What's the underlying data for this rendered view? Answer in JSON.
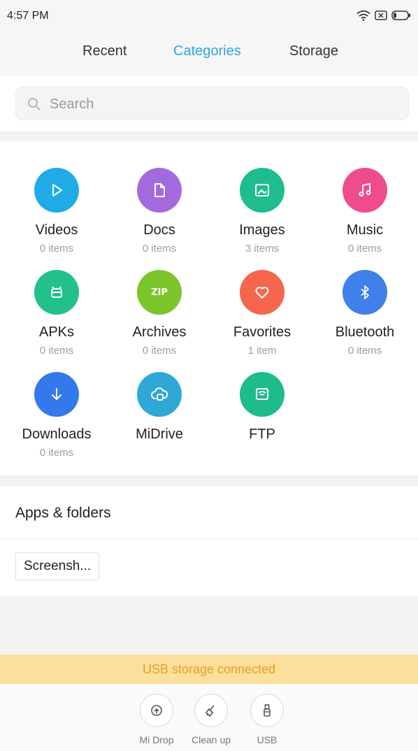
{
  "status_bar": {
    "time": "4:57 PM"
  },
  "tabs": [
    {
      "label": "Recent"
    },
    {
      "label": "Categories",
      "active": true
    },
    {
      "label": "Storage"
    }
  ],
  "search": {
    "placeholder": "Search"
  },
  "categories": [
    {
      "label": "Videos",
      "count": "0 items",
      "color": "#1eabe8",
      "icon": "play-icon"
    },
    {
      "label": "Docs",
      "count": "0 items",
      "color": "#a36ae0",
      "icon": "document-icon"
    },
    {
      "label": "Images",
      "count": "3 items",
      "color": "#1ebd8f",
      "icon": "image-icon"
    },
    {
      "label": "Music",
      "count": "0 items",
      "color": "#f04b8e",
      "icon": "music-note-icon"
    },
    {
      "label": "APKs",
      "count": "0 items",
      "color": "#22c08d",
      "icon": "android-icon"
    },
    {
      "label": "Archives",
      "count": "0 items",
      "color": "#7cc52b",
      "icon": "zip-icon",
      "icon_text": "ZIP"
    },
    {
      "label": "Favorites",
      "count": "1 item",
      "color": "#f4664d",
      "icon": "heart-icon"
    },
    {
      "label": "Bluetooth",
      "count": "0 items",
      "color": "#3f80ea",
      "icon": "bluetooth-icon"
    },
    {
      "label": "Downloads",
      "count": "0 items",
      "color": "#3479ea",
      "icon": "download-arrow-icon"
    },
    {
      "label": "MiDrive",
      "color": "#2fa8d8",
      "icon": "cloud-icon"
    },
    {
      "label": "FTP",
      "color": "#1ebb8c",
      "icon": "ftp-wifi-icon"
    }
  ],
  "apps_folders": {
    "title": "Apps & folders",
    "items": [
      {
        "label": "Screensh..."
      }
    ]
  },
  "usb_banner": {
    "text": "USB storage connected",
    "color": "#e8a020"
  },
  "toolbar": [
    {
      "label": "Mi Drop",
      "icon": "mi-drop-icon"
    },
    {
      "label": "Clean up",
      "icon": "broom-icon"
    },
    {
      "label": "USB",
      "icon": "usb-icon"
    }
  ]
}
